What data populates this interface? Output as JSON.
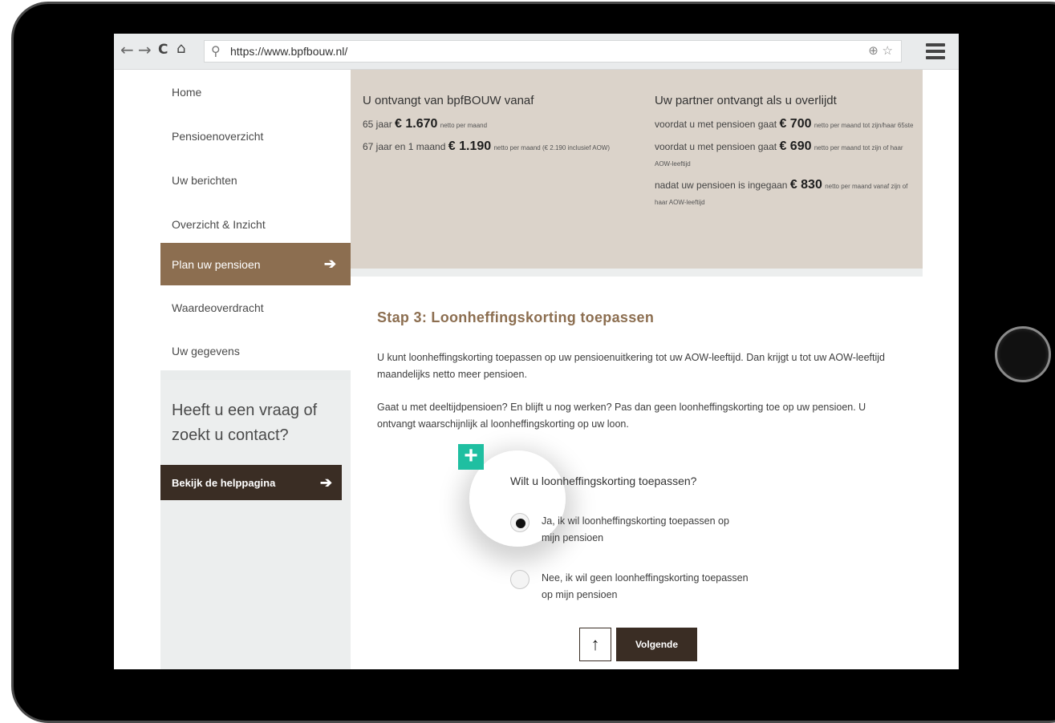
{
  "browser": {
    "url": "https://www.bpfbouw.nl/",
    "back_icon": "arrow-left-icon",
    "forward_icon": "arrow-right-icon",
    "reload_icon": "reload-icon",
    "home_icon": "home-icon",
    "menu_icon": "hamburger-menu-icon"
  },
  "sidebar": {
    "items": [
      {
        "label": "Home"
      },
      {
        "label": "Pensioenoverzicht"
      },
      {
        "label": "Uw berichten"
      },
      {
        "label": "Overzicht & Inzicht"
      },
      {
        "label": "Plan uw pensioen",
        "active": true
      },
      {
        "label": "Waardeoverdracht"
      },
      {
        "label": "Uw gegevens"
      }
    ],
    "help_title": "Heeft u een vraag of zoekt u contact?",
    "help_button": "Bekijk de helppagina"
  },
  "info": {
    "left": {
      "heading": "U ontvangt van bpfBOUW vanaf",
      "line1_pre": "65 jaar",
      "line1_amount": "€ 1.670",
      "line1_post": "netto per maand",
      "line2_pre": "67 jaar en 1 maand",
      "line2_amount": "€ 1.190",
      "line2_post": "netto per maand (€ 2.190 inclusief AOW)"
    },
    "right": {
      "heading": "Uw partner ontvangt als u overlijdt",
      "line1_pre": "voordat u met pensioen gaat",
      "line1_amount": "€ 700",
      "line1_post": "netto per maand tot zijn/haar 65ste",
      "line2_pre": "voordat u met pensioen gaat",
      "line2_amount": "€ 690",
      "line2_post": "netto per maand tot zijn of haar AOW-leeftijd",
      "line3_pre": "nadat uw pensioen is ingegaan",
      "line3_amount": "€ 830",
      "line3_post": "netto per maand vanaf zijn of haar AOW-leeftijd"
    }
  },
  "step": {
    "title": "Stap 3: Loonheffingskorting toepassen",
    "para1": "U kunt loonheffingskorting toepassen op uw pensioenuitkering tot uw AOW-leeftijd. Dan krijgt u tot uw AOW-leeftijd maandelijks netto meer pensioen.",
    "para2": "Gaat u met deeltijdpensioen? En blijft u nog werken? Pas dan geen loonheffingskorting toe op uw pensioen. U ontvangt waarschijnlijk al loonheffingskorting op uw loon.",
    "question": "Wilt u loonheffingskorting toepassen?",
    "option_yes": "Ja, ik wil loonheffingskorting toepassen op mijn pensioen",
    "option_no": "Nee, ik wil geen loonheffingskorting toepassen op mijn pensioen",
    "selected": "yes",
    "next_label": "Volgende",
    "up_icon": "arrow-up-icon"
  },
  "colors": {
    "accent": "#8c6e50",
    "dark": "#3a2d24",
    "panel": "#dbd3ca",
    "highlight": "#1fbfa1"
  }
}
